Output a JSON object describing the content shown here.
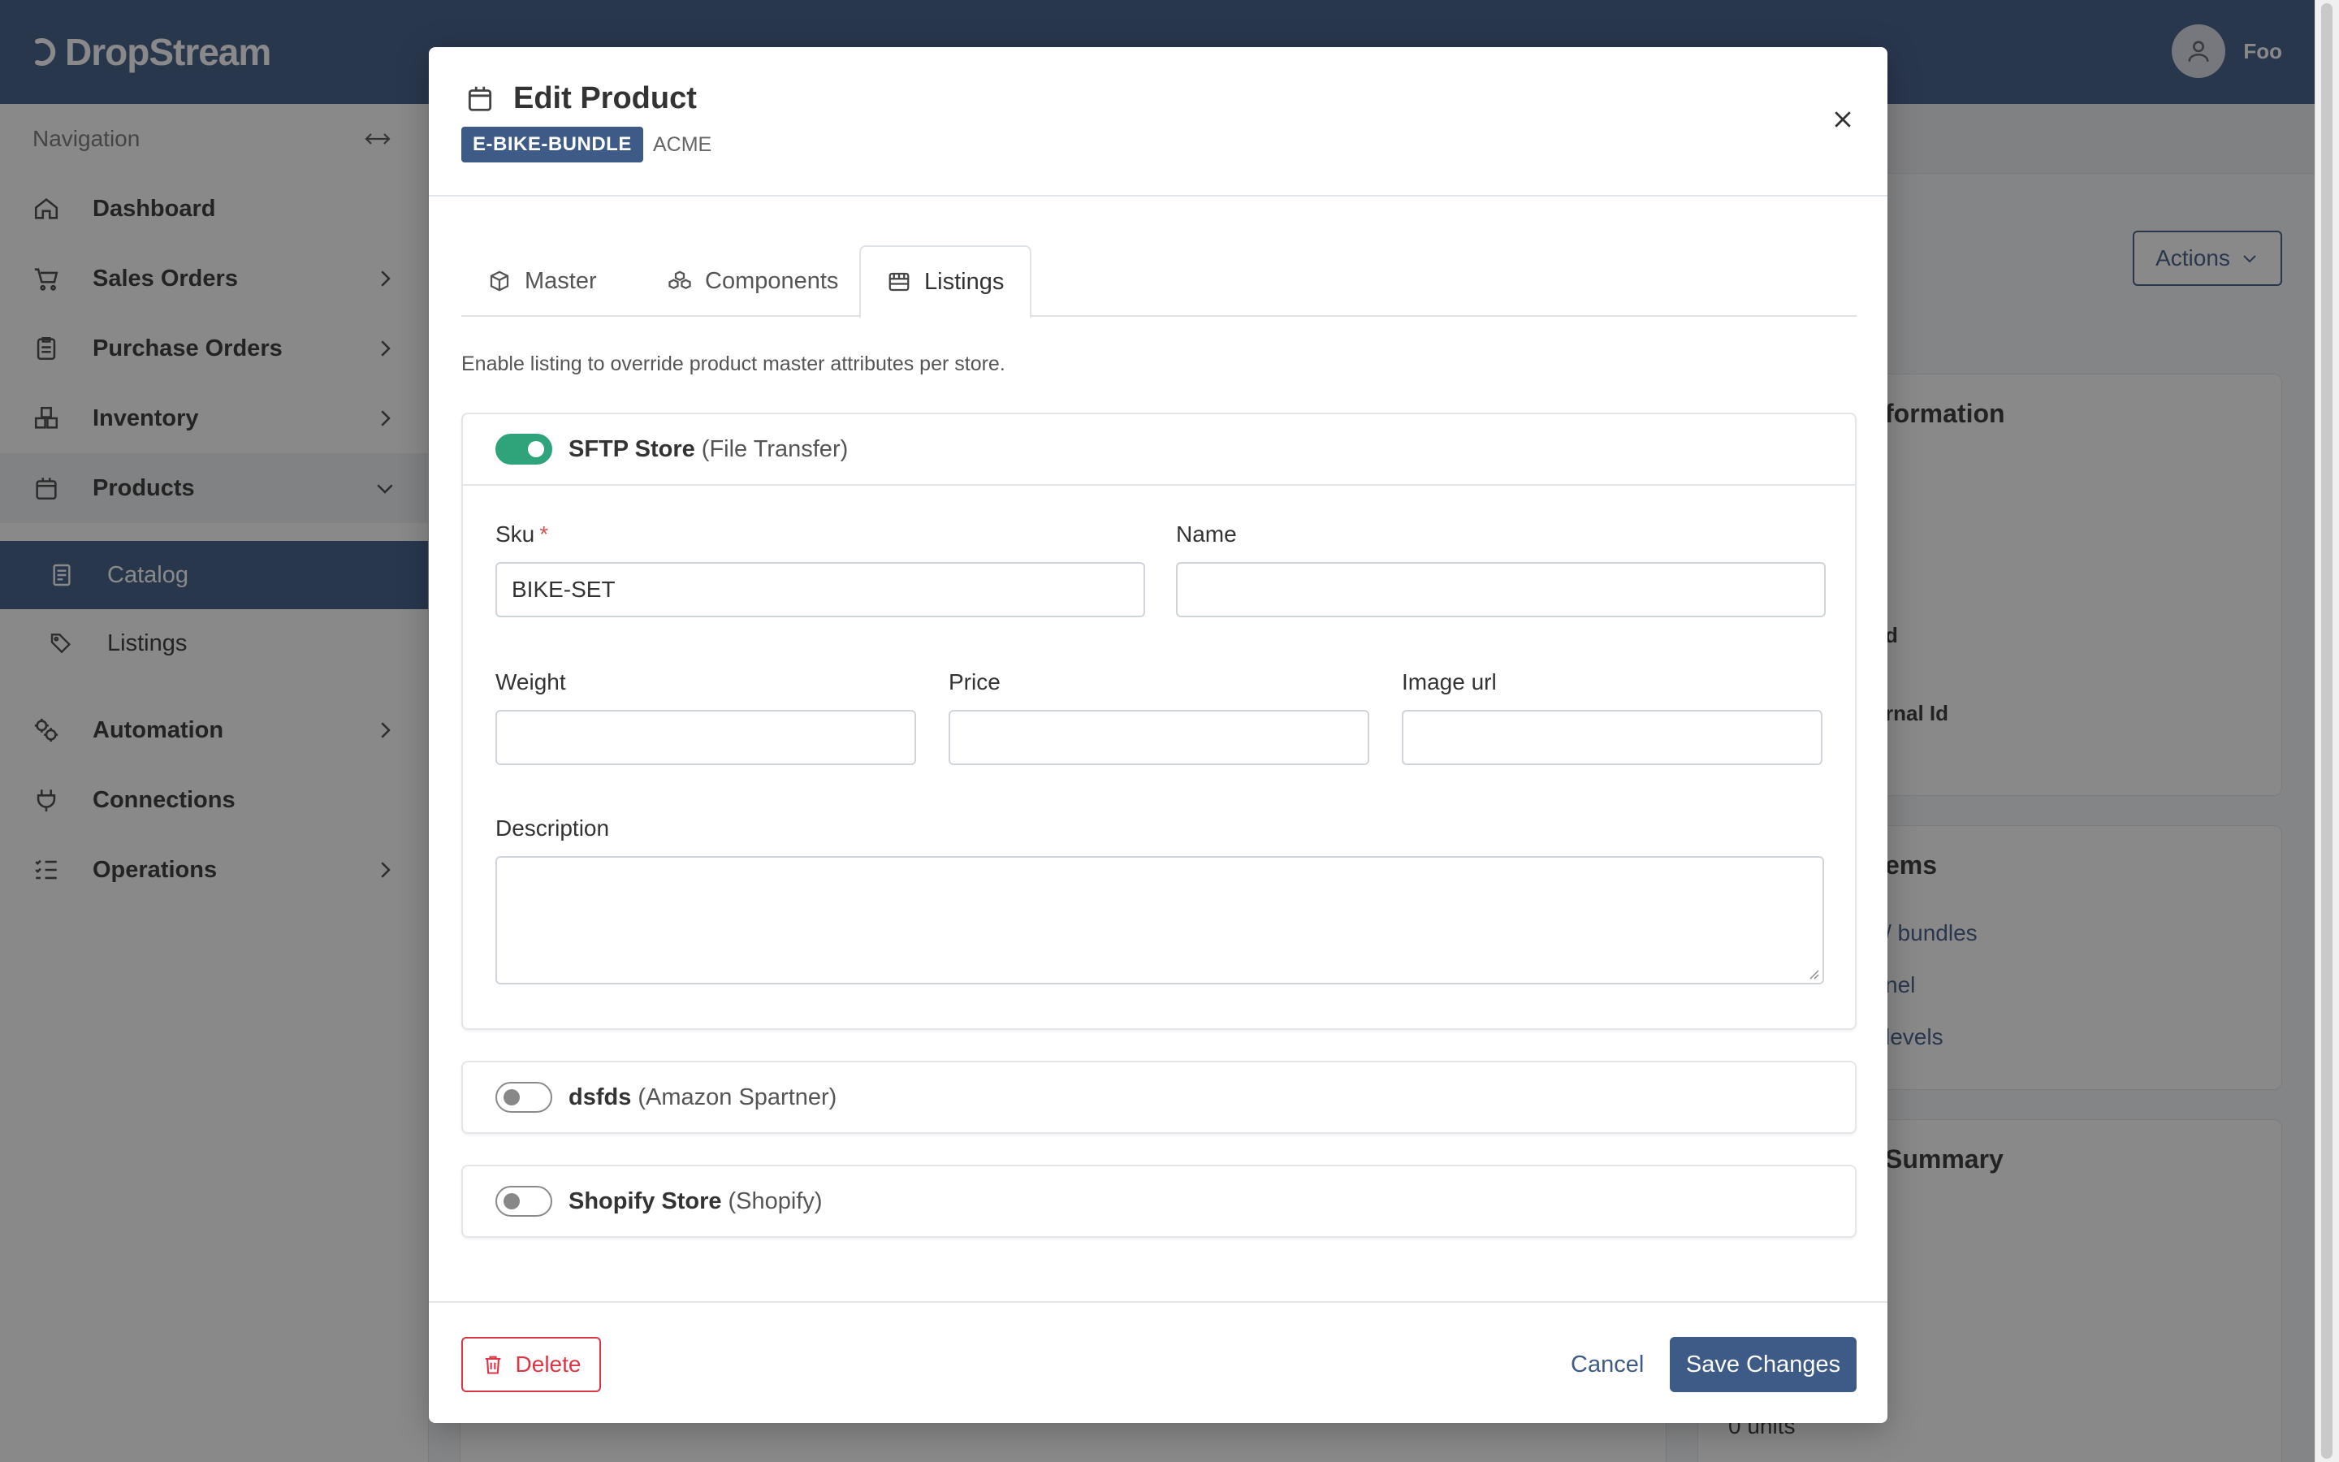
{
  "app": {
    "brand": "DropStream",
    "user_name": "Foo"
  },
  "sidebar": {
    "header": "Navigation",
    "items": [
      {
        "label": "Dashboard"
      },
      {
        "label": "Sales Orders"
      },
      {
        "label": "Purchase Orders"
      },
      {
        "label": "Inventory"
      },
      {
        "label": "Products"
      },
      {
        "label": "Automation"
      },
      {
        "label": "Connections"
      },
      {
        "label": "Operations"
      }
    ],
    "products_sub": [
      {
        "label": "Catalog"
      },
      {
        "label": "Listings"
      }
    ]
  },
  "background": {
    "actions_label": "Actions",
    "card1_title": "formation",
    "card1_d": "d",
    "card1_rnal": "rnal Id",
    "card2_title": "ems",
    "card2_links": [
      "/ bundles",
      "nel",
      "levels"
    ],
    "card3_title": "Summary",
    "units": "0 units"
  },
  "modal": {
    "title": "Edit Product",
    "badge": "E-BIKE-BUNDLE",
    "subtitle": "ACME",
    "tabs": [
      {
        "label": "Master",
        "active": false
      },
      {
        "label": "Components",
        "active": false
      },
      {
        "label": "Listings",
        "active": true
      }
    ],
    "hint": "Enable listing to override product master attributes per store.",
    "stores": [
      {
        "name": "SFTP Store",
        "type": "(File Transfer)",
        "enabled": true,
        "fields": {
          "sku_label": "Sku",
          "sku_required": "*",
          "sku_value": "BIKE-SET",
          "name_label": "Name",
          "name_value": "",
          "weight_label": "Weight",
          "weight_value": "",
          "price_label": "Price",
          "price_value": "",
          "image_label": "Image url",
          "image_value": "",
          "description_label": "Description",
          "description_value": ""
        }
      },
      {
        "name": "dsfds",
        "type": "(Amazon Spartner)",
        "enabled": false
      },
      {
        "name": "Shopify Store",
        "type": "(Shopify)",
        "enabled": false
      }
    ],
    "footer": {
      "delete_label": "Delete",
      "cancel_label": "Cancel",
      "save_label": "Save Changes"
    }
  },
  "colors": {
    "primary": "#3e5a86",
    "toggle_on": "#2fa37a",
    "danger": "#dc3545"
  }
}
